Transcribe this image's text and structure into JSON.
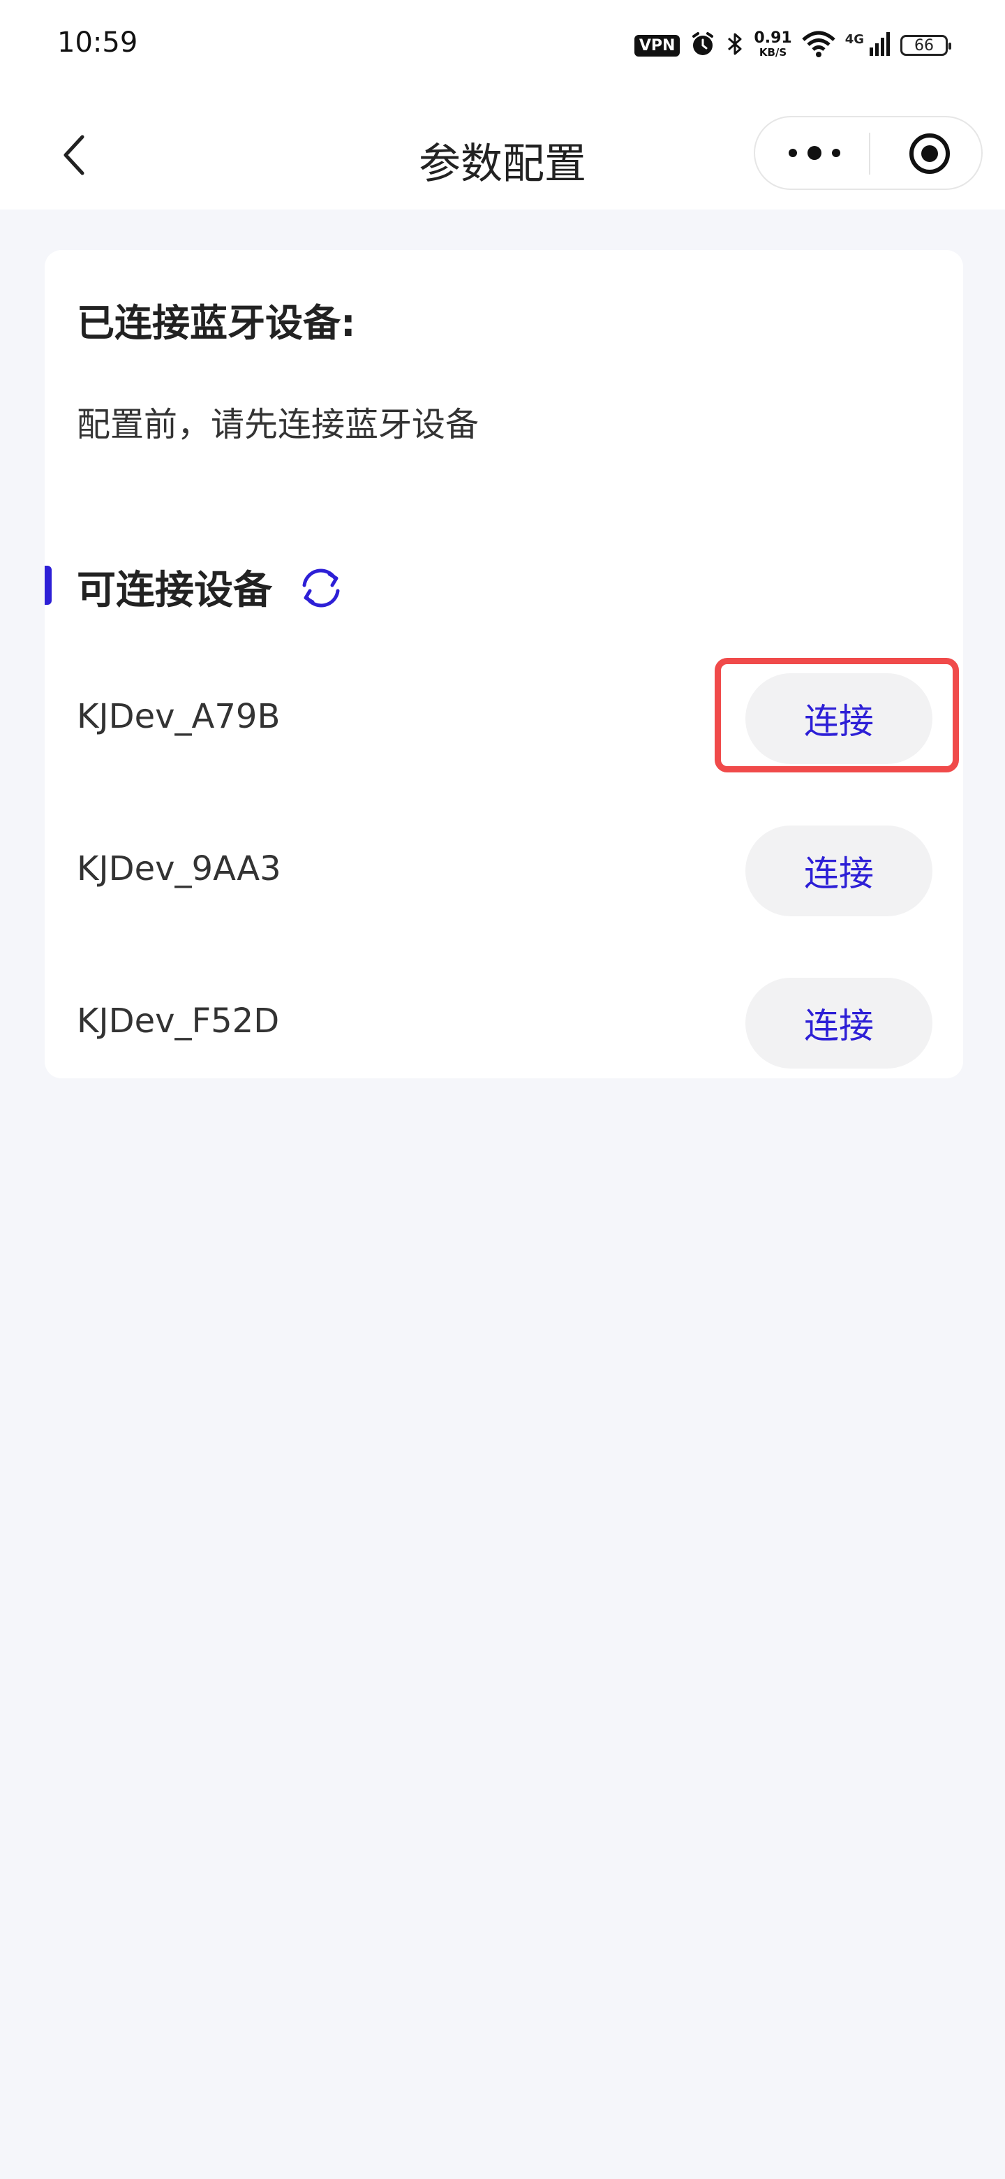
{
  "status_bar": {
    "time": "10:59",
    "vpn": "VPN",
    "net_speed_value": "0.91",
    "net_speed_unit": "KB/S",
    "network_gen": "4G",
    "battery": "66"
  },
  "nav": {
    "title": "参数配置",
    "icons": [
      "back-icon",
      "more-icon",
      "close-target-icon"
    ]
  },
  "connected": {
    "title": "已连接蓝牙设备:",
    "hint": "配置前，请先连接蓝牙设备"
  },
  "available": {
    "title": "可连接设备",
    "refresh_icon": "refresh-icon",
    "devices": [
      {
        "name": "KJDev_A79B",
        "button": "连接"
      },
      {
        "name": "KJDev_9AA3",
        "button": "连接"
      },
      {
        "name": "KJDev_F52D",
        "button": "连接"
      }
    ]
  },
  "colors": {
    "accent": "#2d1fd6",
    "highlight": "#f04a4a",
    "background": "#f5f6fa"
  }
}
